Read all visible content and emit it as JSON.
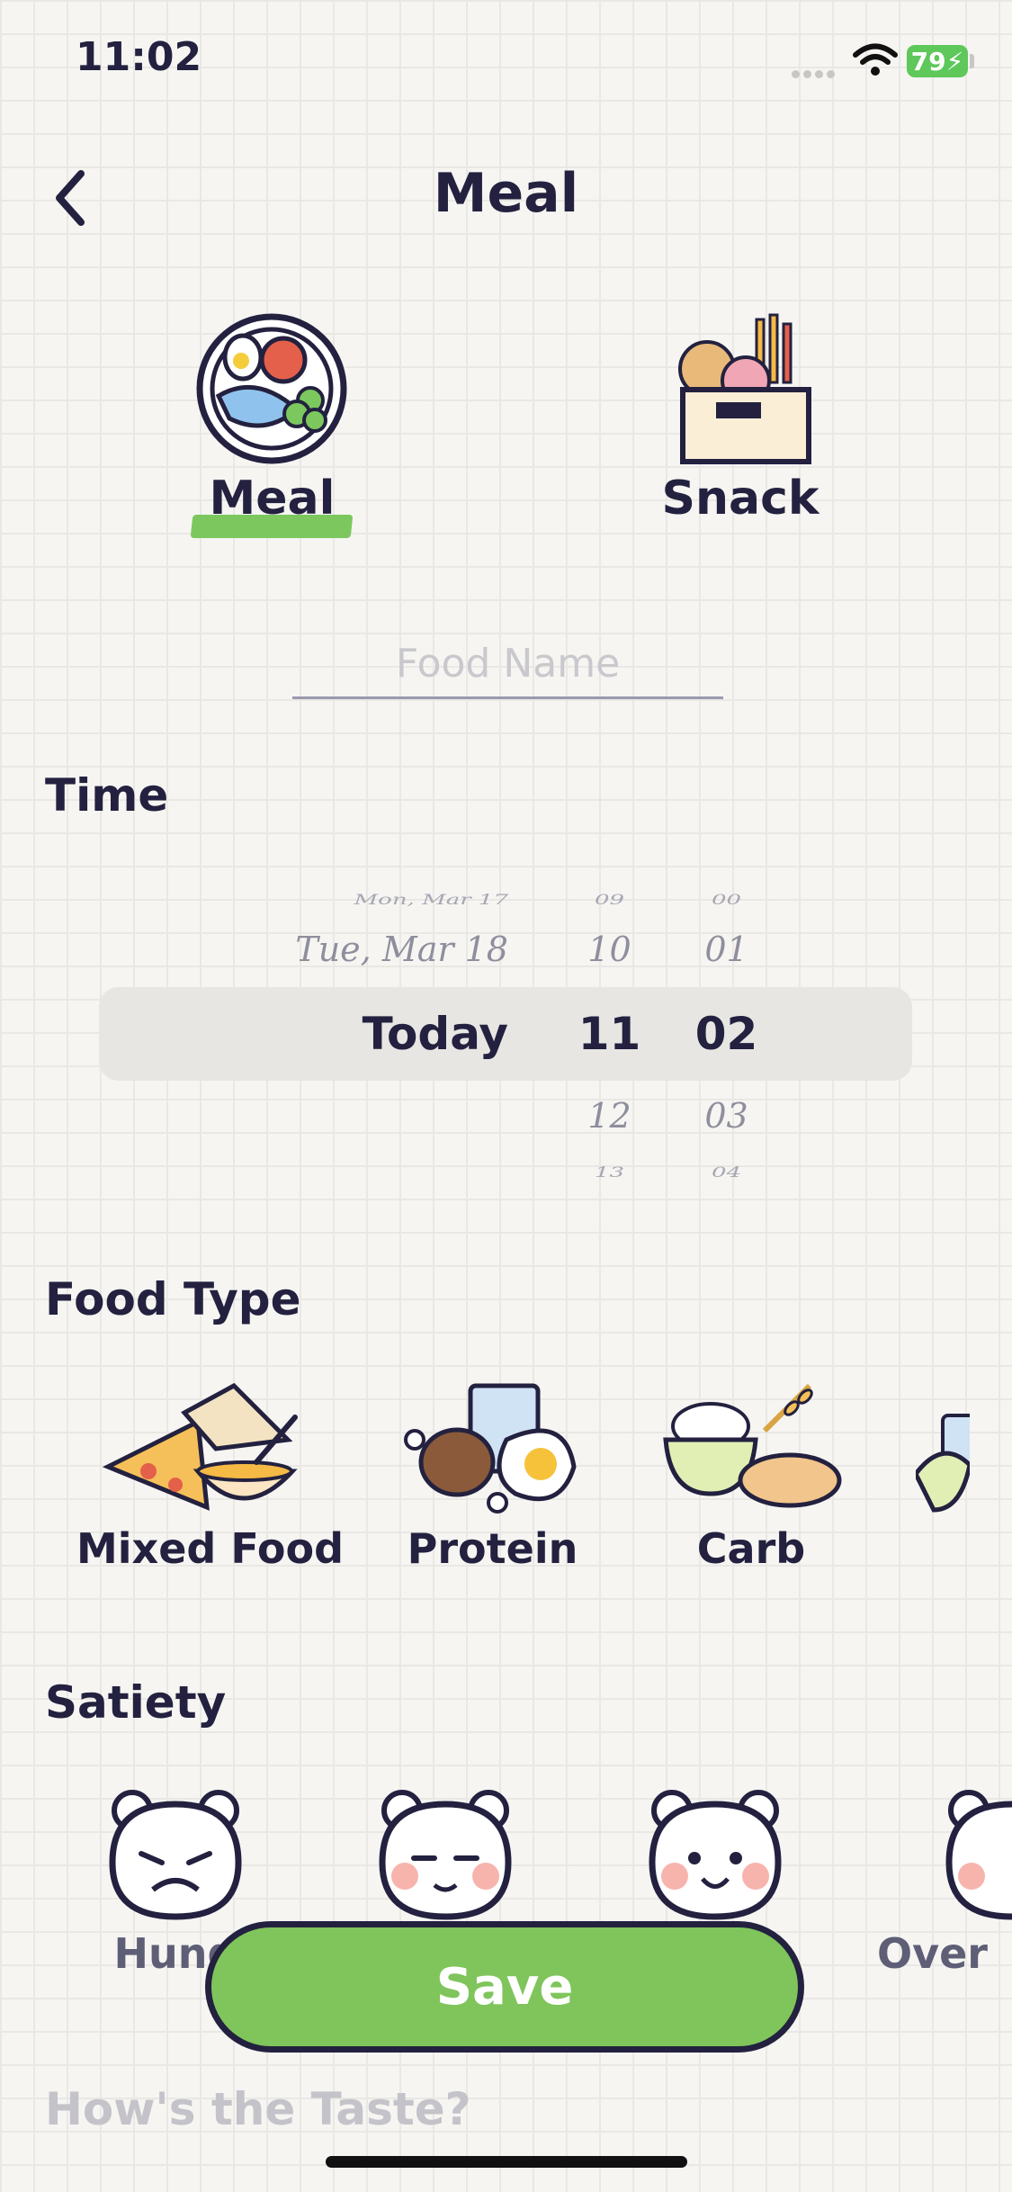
{
  "status_bar": {
    "time": "11:02",
    "battery": "79"
  },
  "nav": {
    "title": "Meal"
  },
  "meal_types": [
    {
      "label": "Meal",
      "selected": true
    },
    {
      "label": "Snack",
      "selected": false
    }
  ],
  "food_name": {
    "placeholder": "Food Name",
    "value": ""
  },
  "time_section": {
    "title": "Time",
    "picker": {
      "dates": [
        "Mon, Mar 17",
        "Tue, Mar 18",
        "Today"
      ],
      "hours": [
        "09",
        "10",
        "11",
        "12",
        "13"
      ],
      "minutes": [
        "00",
        "01",
        "02",
        "03",
        "04"
      ],
      "selected": {
        "date": "Today",
        "hour": "11",
        "minute": "02"
      }
    }
  },
  "food_type_section": {
    "title": "Food Type",
    "items": [
      {
        "label": "Mixed Food",
        "icon": "pizza-sandwich-soup-icon"
      },
      {
        "label": "Protein",
        "icon": "meat-milk-egg-icon"
      },
      {
        "label": "Carb",
        "icon": "rice-bread-wheat-icon"
      }
    ]
  },
  "satiety_section": {
    "title": "Satiety",
    "items": [
      {
        "label": "Hung",
        "icon": "hungry-bear-icon"
      },
      {
        "label": "",
        "icon": "content-bear-icon"
      },
      {
        "label": "",
        "icon": "happy-bear-icon"
      },
      {
        "label": "Over",
        "icon": "overfull-bear-icon"
      }
    ]
  },
  "save_button": {
    "label": "Save"
  },
  "taste_section": {
    "title": "How's the Taste?"
  },
  "colors": {
    "accent_green": "#7fc55b",
    "ink": "#23213f",
    "battery_green": "#5ec85a"
  }
}
